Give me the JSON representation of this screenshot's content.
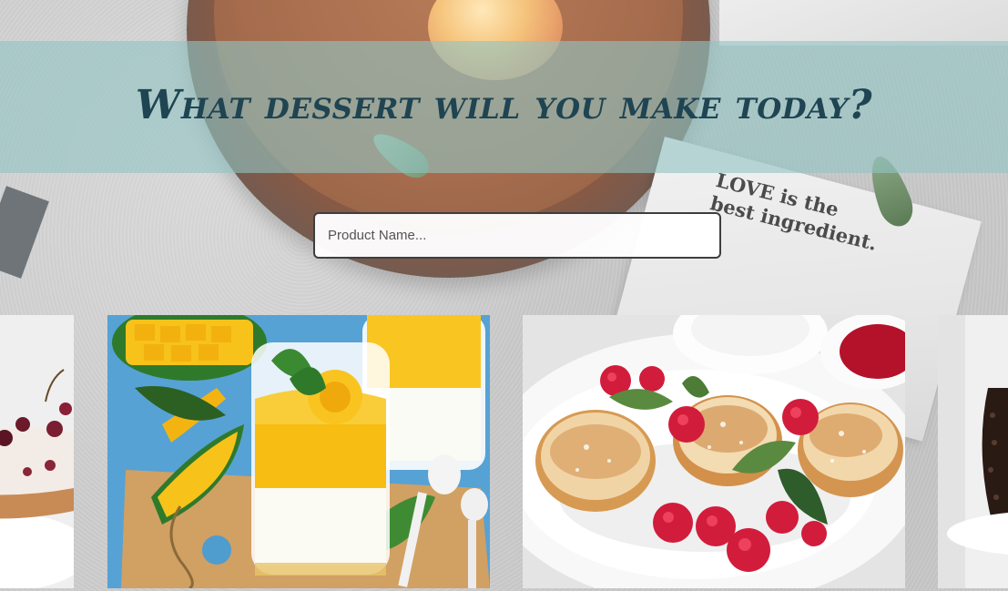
{
  "header": {
    "title": "What dessert will you make today?"
  },
  "search": {
    "placeholder": "Product Name...",
    "value": ""
  },
  "background": {
    "napkin_text": "LOVE is the\nbest ingredient."
  },
  "colors": {
    "banner": "#91c3c1",
    "title": "#1f4452",
    "input_border": "#3e3e3e"
  },
  "cards": [
    {
      "id": "cherry-tart",
      "image": "cherry-tart-image"
    },
    {
      "id": "mango-panna-cotta",
      "image": "mango-panna-cotta-image"
    },
    {
      "id": "syrniki-raspberries",
      "image": "syrniki-image"
    },
    {
      "id": "chocolate-cake",
      "image": "chocolate-cake-image"
    }
  ]
}
